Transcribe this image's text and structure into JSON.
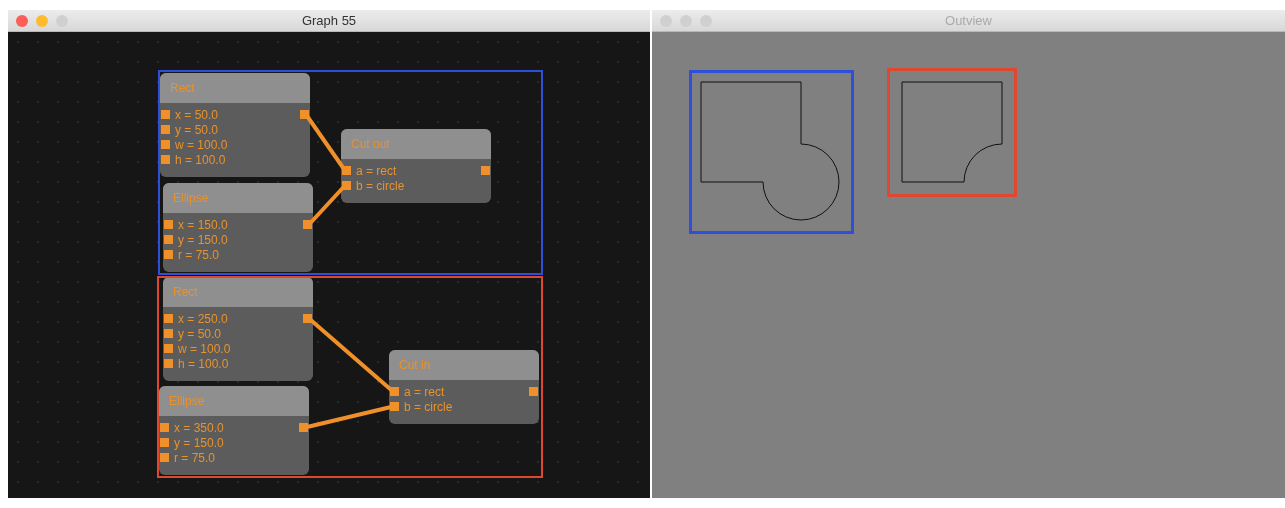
{
  "graph_window": {
    "title": "Graph 55",
    "active": true
  },
  "groups": [
    {
      "color": "#2f4fd8",
      "nodes": [
        {
          "title": "Rect",
          "params": [
            "x = 50.0",
            "y = 50.0",
            "w = 100.0",
            "h = 100.0"
          ]
        },
        {
          "title": "Ellipse",
          "params": [
            "x = 150.0",
            "y = 150.0",
            "r = 75.0"
          ]
        },
        {
          "title": "Cut out",
          "params": [
            "a = rect",
            "b = circle"
          ]
        }
      ]
    },
    {
      "color": "#e0472f",
      "nodes": [
        {
          "title": "Rect",
          "params": [
            "x = 250.0",
            "y = 50.0",
            "w = 100.0",
            "h = 100.0"
          ]
        },
        {
          "title": "Ellipse",
          "params": [
            "x = 350.0",
            "y = 150.0",
            "r = 75.0"
          ]
        },
        {
          "title": "Cut in",
          "params": [
            "a = rect",
            "b = circle"
          ]
        }
      ]
    }
  ],
  "outview_window": {
    "title": "Outview",
    "active": false
  },
  "outputs": [
    {
      "kind": "union",
      "color": "#2f4fd8"
    },
    {
      "kind": "difference",
      "color": "#e0472f"
    }
  ]
}
